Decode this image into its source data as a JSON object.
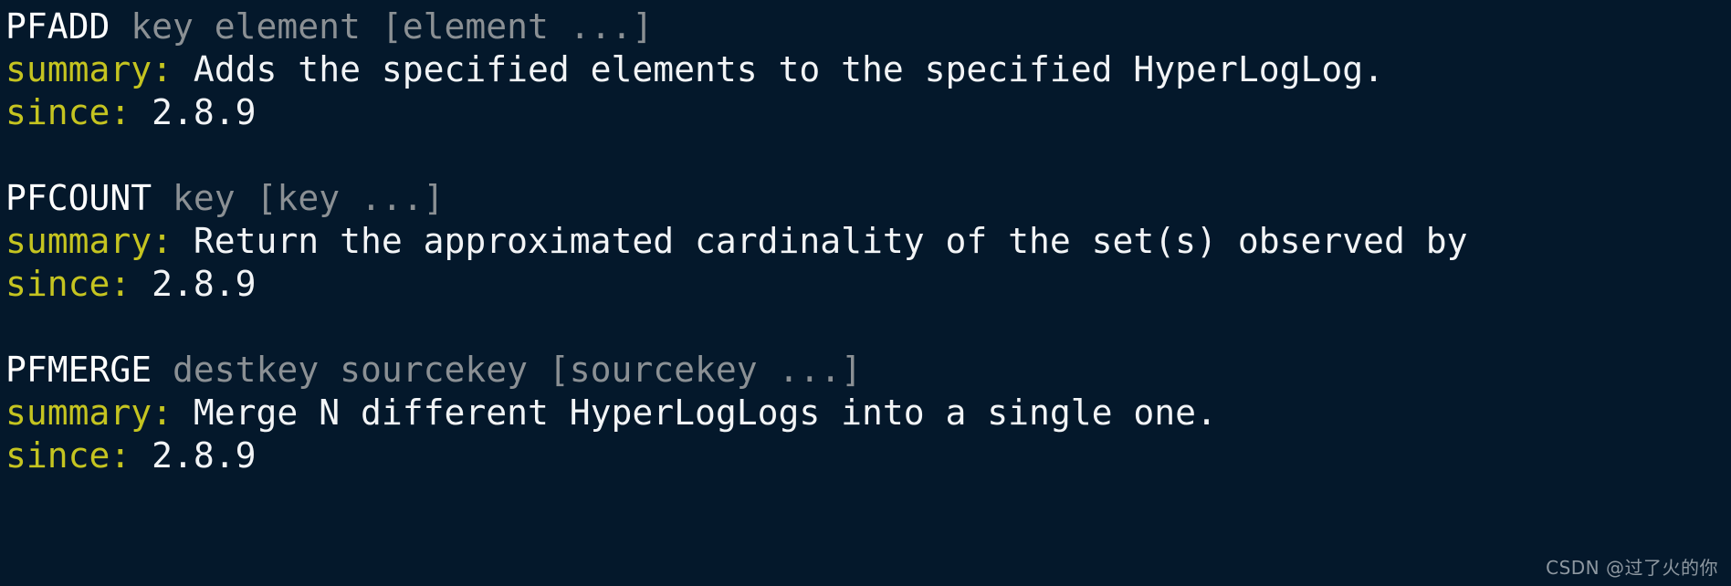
{
  "terminal": {
    "background_color": "#04182b",
    "command_name_color": "#ffffff",
    "command_args_color": "#8b9094",
    "field_label_color": "#c5c420",
    "field_value_color": "#f2f4f6",
    "blocks": [
      {
        "command": "PFADD",
        "args": "key element [element ...]",
        "summary_label": "summary:",
        "summary_value": "Adds the specified elements to the specified HyperLogLog.",
        "since_label": "since:",
        "since_value": "2.8.9"
      },
      {
        "command": "PFCOUNT",
        "args": "key [key ...]",
        "summary_label": "summary:",
        "summary_value": "Return the approximated cardinality of the set(s) observed by",
        "since_label": "since:",
        "since_value": "2.8.9"
      },
      {
        "command": "PFMERGE",
        "args": "destkey sourcekey [sourcekey ...]",
        "summary_label": "summary:",
        "summary_value": "Merge N different HyperLogLogs into a single one.",
        "since_label": "since:",
        "since_value": "2.8.9"
      }
    ]
  },
  "watermark": {
    "text": "CSDN @过了火的你"
  }
}
